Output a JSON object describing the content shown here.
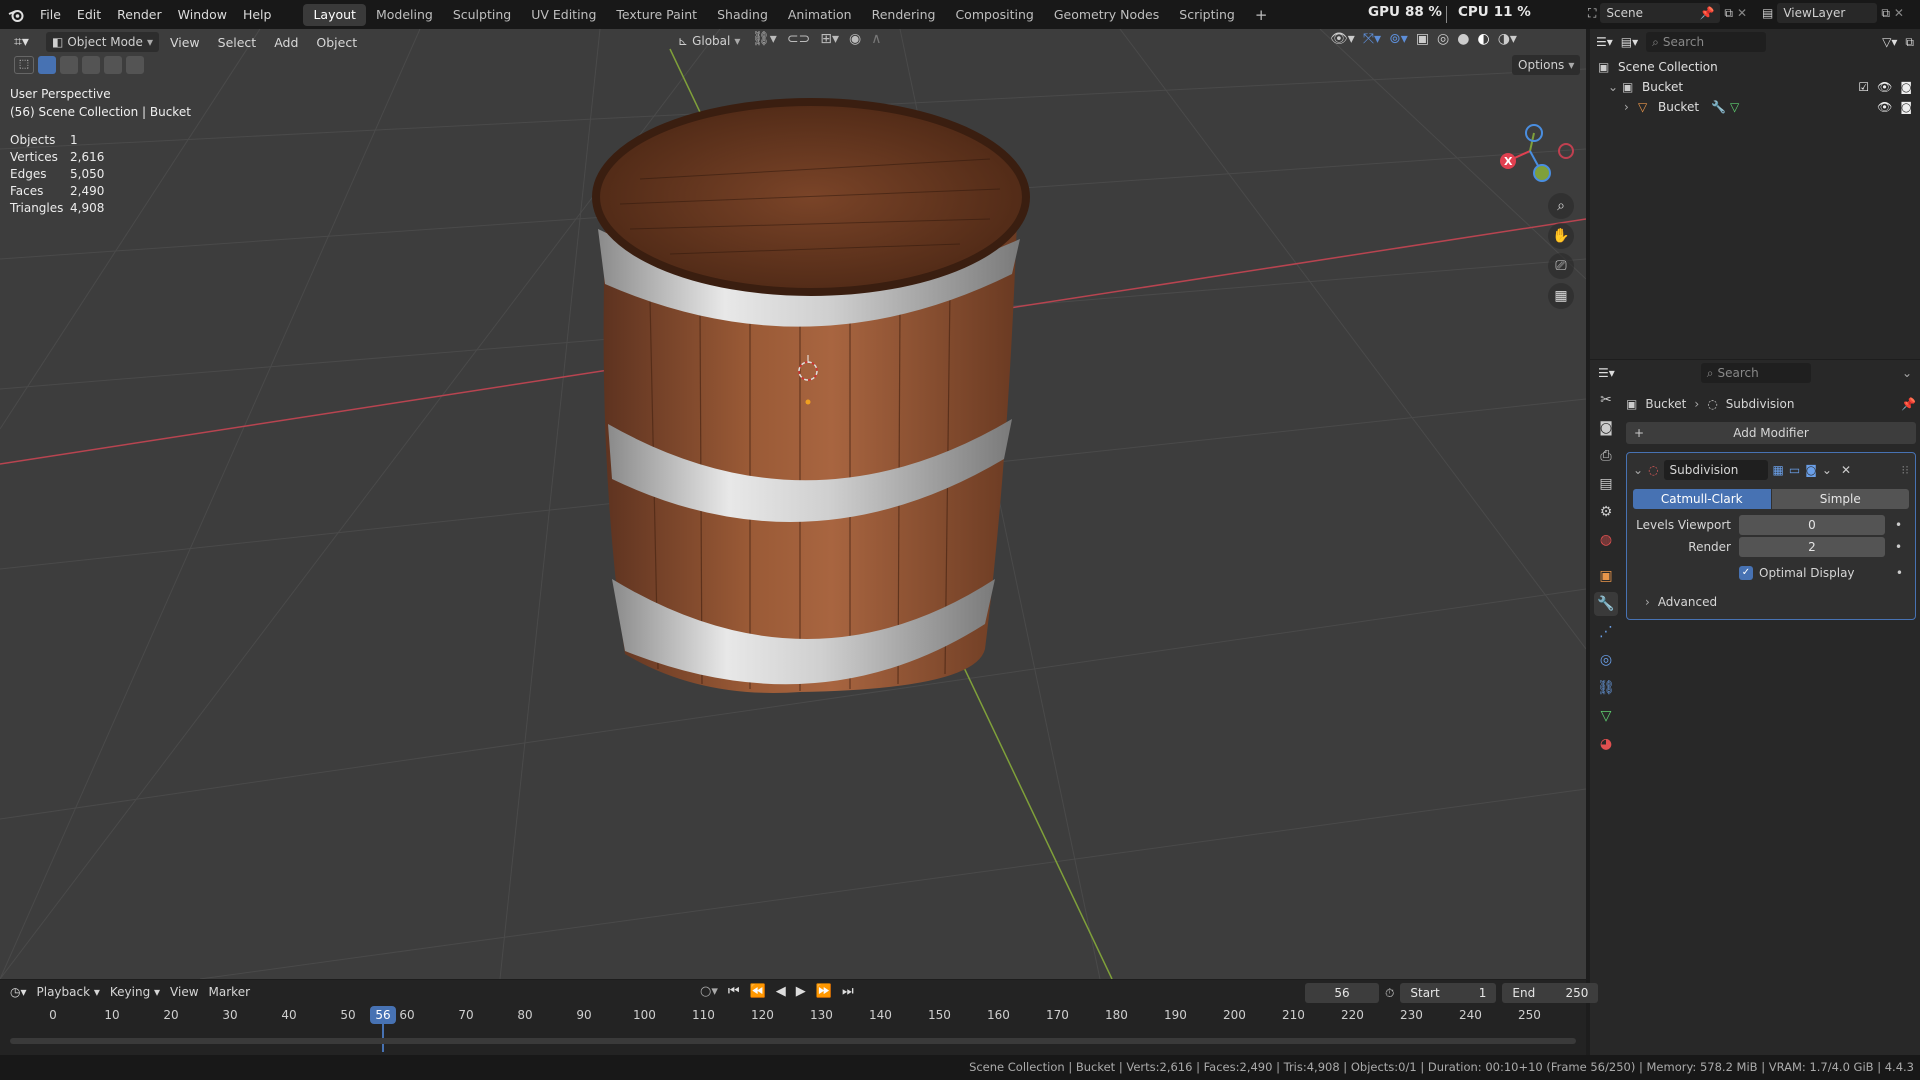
{
  "app": {
    "name": "Blender"
  },
  "menus": [
    "File",
    "Edit",
    "Render",
    "Window",
    "Help"
  ],
  "workspaces": [
    {
      "label": "Layout",
      "active": true
    },
    {
      "label": "Modeling"
    },
    {
      "label": "Sculpting"
    },
    {
      "label": "UV Editing"
    },
    {
      "label": "Texture Paint"
    },
    {
      "label": "Shading"
    },
    {
      "label": "Animation"
    },
    {
      "label": "Rendering"
    },
    {
      "label": "Compositing"
    },
    {
      "label": "Geometry Nodes"
    },
    {
      "label": "Scripting"
    }
  ],
  "add_workspace": "+",
  "perf": {
    "gpu_label": "GPU",
    "gpu_value": "88 %",
    "cpu_label": "CPU",
    "cpu_value": "11 %"
  },
  "scene": {
    "name": "Scene",
    "view_layer": "ViewLayer"
  },
  "viewport": {
    "mode": "Object Mode",
    "menus": [
      "View",
      "Select",
      "Add",
      "Object"
    ],
    "transform_orientation": "Global",
    "options_label": "Options",
    "overlay_title": "User Perspective",
    "overlay_subtitle": "(56) Scene Collection | Bucket",
    "stats": [
      {
        "key": "Objects",
        "value": "1"
      },
      {
        "key": "Vertices",
        "value": "2,616"
      },
      {
        "key": "Edges",
        "value": "5,050"
      },
      {
        "key": "Faces",
        "value": "2,490"
      },
      {
        "key": "Triangles",
        "value": "4,908"
      }
    ],
    "axis_labels": {
      "x": "X"
    }
  },
  "outliner": {
    "search_placeholder": "Search",
    "root": "Scene Collection",
    "collection": "Bucket",
    "object": "Bucket"
  },
  "properties": {
    "search_placeholder": "Search",
    "breadcrumb_object": "Bucket",
    "breadcrumb_modifier": "Subdivision",
    "add_modifier": "Add Modifier",
    "modifier_name": "Subdivision",
    "algo_options": [
      "Catmull-Clark",
      "Simple"
    ],
    "algo_selected": "Catmull-Clark",
    "levels_viewport_label": "Levels Viewport",
    "levels_viewport_value": "0",
    "render_label": "Render",
    "render_value": "2",
    "optimal_display_label": "Optimal Display",
    "optimal_display_checked": true,
    "advanced_label": "Advanced"
  },
  "timeline": {
    "menus": [
      "Playback",
      "Keying",
      "View",
      "Marker"
    ],
    "current_frame": "56",
    "start_label": "Start",
    "start_value": "1",
    "end_label": "End",
    "end_value": "250",
    "ticks": [
      "0",
      "10",
      "20",
      "30",
      "40",
      "50",
      "60",
      "70",
      "80",
      "90",
      "100",
      "110",
      "120",
      "130",
      "140",
      "150",
      "160",
      "170",
      "180",
      "190",
      "200",
      "210",
      "220",
      "230",
      "240",
      "250"
    ]
  },
  "statusbar": {
    "text": "Scene Collection | Bucket | Verts:2,616 | Faces:2,490 | Tris:4,908 | Objects:0/1 | Duration: 00:10+10 (Frame 56/250) | Memory: 578.2 MiB | VRAM: 1.7/4.0 GiB | 4.4.3"
  },
  "colors": {
    "accent": "#4772b3",
    "x_axis": "#e04050",
    "y_axis": "#7fa03a",
    "z_axis": "#4a8ee0",
    "wood": "#8a4e2c",
    "metal": "#c8c8c8"
  }
}
